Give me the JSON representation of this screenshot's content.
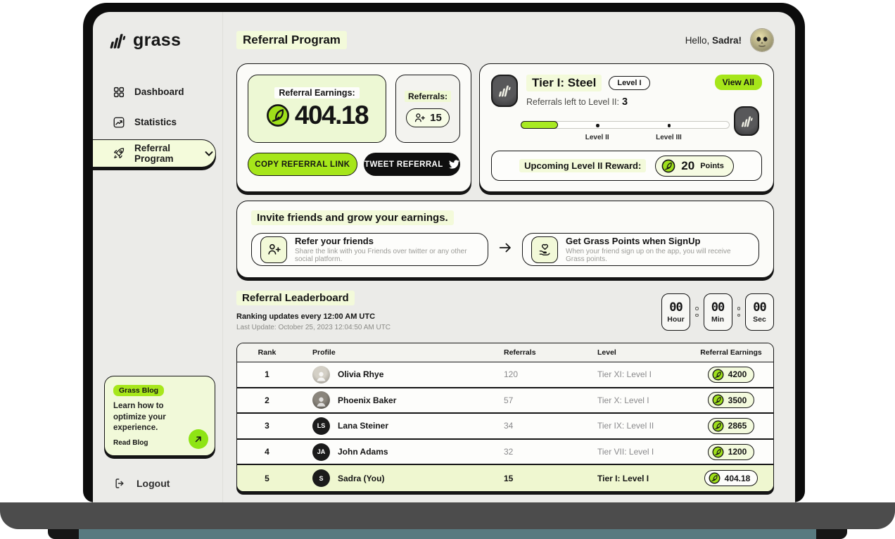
{
  "brand": {
    "name": "grass"
  },
  "sidebar": {
    "items": [
      {
        "label": "Dashboard"
      },
      {
        "label": "Statistics"
      },
      {
        "label": "Referral Program"
      }
    ],
    "blog": {
      "badge": "Grass Blog",
      "text": "Learn how to optimize your experience.",
      "link": "Read Blog"
    },
    "logout_label": "Logout"
  },
  "header": {
    "title": "Referral Program",
    "greeting": "Hello,",
    "username": "Sadra!"
  },
  "earnings_card": {
    "label": "Referral Earnings:",
    "value": "404.18",
    "referrals_label": "Referrals:",
    "referrals_count": "15",
    "copy_button": "COPY REFERRAL LINK",
    "tweet_button": "TWEET REFERRAL"
  },
  "tier_card": {
    "title": "Tier I: Steel",
    "level_badge": "Level I",
    "view_all": "View All",
    "sub_label": "Referrals left to Level II:",
    "sub_value": "3",
    "milestones": [
      "Level II",
      "Level III"
    ],
    "progress_percent": 18,
    "reward_label": "Upcoming Level II Reward:",
    "reward_value": "20",
    "reward_unit": "Points"
  },
  "invite": {
    "heading": "Invite friends and grow your earnings.",
    "steps": [
      {
        "title": "Refer your friends",
        "desc": "Share the link with you Friends over twitter or any other social platform."
      },
      {
        "title": "Get Grass Points when SignUp",
        "desc": "When your friend sign up on the app, you will receive Grass points."
      }
    ]
  },
  "leaderboard": {
    "title": "Referral Leaderboard",
    "subtitle": "Ranking updates every 12:00 AM UTC",
    "last_update": "Last Update: October 25, 2023 12:04:50 AM UTC",
    "countdown": [
      {
        "value": "00",
        "unit": "Hour"
      },
      {
        "value": "00",
        "unit": "Min"
      },
      {
        "value": "00",
        "unit": "Sec"
      }
    ],
    "columns": [
      "Rank",
      "Profile",
      "Referrals",
      "Level",
      "Referral Earnings"
    ],
    "rows": [
      {
        "rank": "1",
        "name": "Olivia Rhye",
        "initials": "",
        "referrals": "120",
        "level": "Tier XI: Level I",
        "earnings": "4200"
      },
      {
        "rank": "2",
        "name": "Phoenix Baker",
        "initials": "",
        "referrals": "57",
        "level": "Tier X: Level I",
        "earnings": "3500"
      },
      {
        "rank": "3",
        "name": "Lana Steiner",
        "initials": "LS",
        "referrals": "34",
        "level": "Tier IX: Level II",
        "earnings": "2865"
      },
      {
        "rank": "4",
        "name": "John Adams",
        "initials": "JA",
        "referrals": "32",
        "level": "Tier VII: Level I",
        "earnings": "1200"
      },
      {
        "rank": "5",
        "name": "Sadra (You)",
        "initials": "S",
        "referrals": "15",
        "level": "Tier I: Level I",
        "earnings": "404.18"
      }
    ]
  },
  "colors": {
    "accent": "#a6e61a",
    "highlight": "#f3fada",
    "ink": "#141414",
    "base_teal": "#587a80"
  }
}
